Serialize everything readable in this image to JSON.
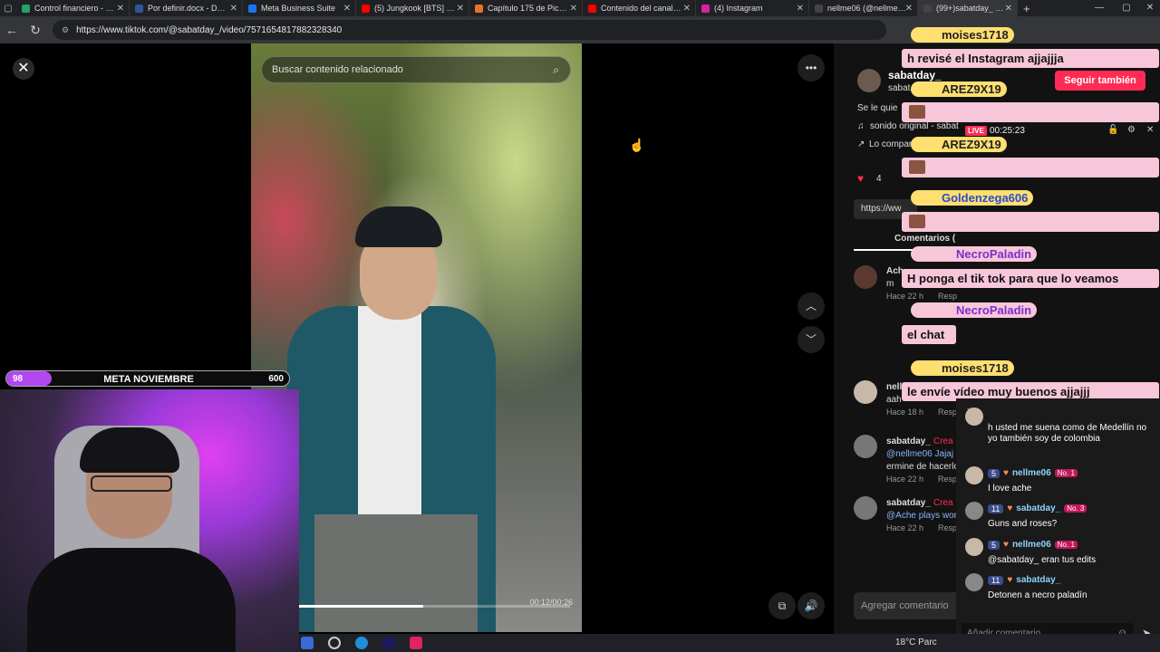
{
  "tabs": [
    {
      "title": "Control financiero - He",
      "color": "#21a366"
    },
    {
      "title": "Por definir.docx - Docu",
      "color": "#2b579a"
    },
    {
      "title": "Meta Business Suite",
      "color": "#1877f2"
    },
    {
      "title": "(5) Jungkook [BTS] - Sti",
      "color": "#ff0000"
    },
    {
      "title": "Capítulo 175 de Pick m",
      "color": "#e8742a"
    },
    {
      "title": "Contenido del canal - Y",
      "color": "#ff0000"
    },
    {
      "title": "(4) Instagram",
      "color": "#d6249f"
    },
    {
      "title": "nellme06 (@nellme06)",
      "color": "#000000"
    },
    {
      "title": "(99+)sabatday_ (@",
      "color": "#000000"
    }
  ],
  "address": {
    "url": "https://www.tiktok.com/@sabatday_/video/7571654817882328340"
  },
  "video": {
    "search_placeholder": "Buscar contenido relacionado",
    "time": "00:12/00:26",
    "progress": 0.46,
    "close_glyph": "✕",
    "more_glyph": "•••",
    "up_glyph": "︿",
    "down_glyph": "﹀"
  },
  "right": {
    "author": "sabatday_",
    "author_sub": "sabat",
    "follow_label": "Seguir también",
    "desc": "Se le quie",
    "sound": "sonido original - sabat",
    "company": "Lo compar",
    "likes": "4",
    "link": "https://ww",
    "comments_tab": "Comentarios (",
    "add_comment": "Agregar comentario",
    "comments": [
      {
        "user": "Ach",
        "text": "m",
        "time": "Hace 22 h",
        "reply": "Resp"
      },
      {
        "user": "nell",
        "text": "aah",
        "time": "Hace 18 h",
        "reply": "Resp"
      },
      {
        "user": "sabatday_",
        "creator": "Crea",
        "text": "@nellme06 Jajaj",
        "text2": "ermine de hacerlo",
        "time": "Hace 22 h",
        "reply": "Resp"
      },
      {
        "user": "sabatday_",
        "creator": "Crea",
        "text": "@Ache plays wor",
        "time": "Hace 22 h",
        "reply": "Resp"
      }
    ]
  },
  "goal": {
    "current": "98",
    "title": "META NOVIEMBRE",
    "target": "600",
    "fraction": 0.16
  },
  "overlay_chat": [
    {
      "user": "moises1718",
      "message": "h revisé el Instagram ajjajjja",
      "kind": "text"
    },
    {
      "user": "AREZ9X19",
      "message": "",
      "kind": "emote"
    },
    {
      "user": "AREZ9X19",
      "message": "",
      "kind": "emote"
    },
    {
      "user": "Goldenzega606",
      "message": "",
      "kind": "emote"
    },
    {
      "user": "NecroPaladin",
      "message": "H ponga el tik tok para que lo veamos",
      "kind": "text"
    },
    {
      "user": "NecroPaladin",
      "message": "el chat",
      "kind": "text"
    },
    {
      "user": "moises1718",
      "message": "le envíe vídeo muy buenos ajjajjj",
      "kind": "text"
    }
  ],
  "live": {
    "badge": "LIVE",
    "timer": "00:25:23"
  },
  "livechat": {
    "messages": [
      {
        "text": "h usted me suena como de Medellín no yo también soy de colombia"
      },
      {
        "level": "5",
        "user": "nellme06",
        "rank": "No. 1",
        "text": "I love ache"
      },
      {
        "level": "11",
        "user": "sabatday_",
        "rank": "No. 3",
        "text": "Guns and roses?"
      },
      {
        "level": "5",
        "user": "nellme06",
        "rank": "No. 1",
        "text": "@sabatday_ eran tus edits"
      },
      {
        "level": "11",
        "user": "sabatday_",
        "rank": "",
        "text": "Detonen a necro paladín"
      }
    ],
    "input_placeholder": "Añadir comentario"
  },
  "taskbar": {
    "weather": "18°C",
    "weather_sub": "Parc"
  }
}
